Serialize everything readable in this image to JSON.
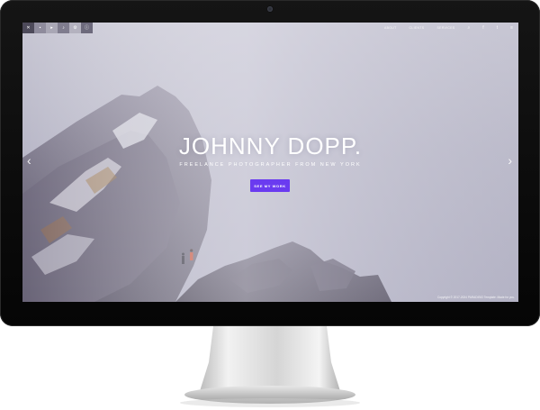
{
  "hero": {
    "title": "JOHNNY DOPP.",
    "subtitle": "FREELANCE PHOTOGRAPHER FROM NEW YORK",
    "cta_label": "SEE MY WORK"
  },
  "nav": {
    "links": [
      "ABOUT",
      "CLIENTS",
      "SERVICES"
    ],
    "icons": [
      "search-icon",
      "facebook-icon",
      "twitter-icon",
      "menu-icon"
    ]
  },
  "thumbs": {
    "icons": [
      "close-icon",
      "camera-icon",
      "video-icon",
      "audio-icon",
      "settings-icon",
      "info-icon"
    ]
  },
  "footer": {
    "copyright": "Copyright © 2017-2024 PARADISIO Template. Made for you."
  },
  "colors": {
    "accent": "#6a3bf0",
    "sky": "#c7c6d3",
    "bezel": "#0b0b0b"
  }
}
